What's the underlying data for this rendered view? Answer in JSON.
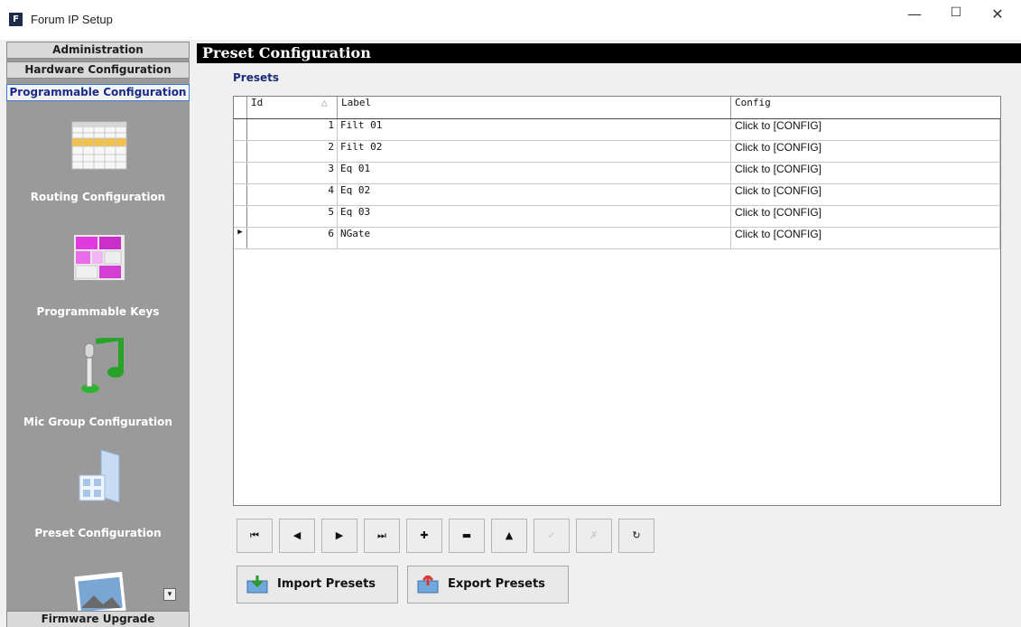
{
  "window": {
    "title": "Forum IP Setup",
    "app_icon_letter": "F",
    "minimize_glyph": "—",
    "maximize_glyph": "☐",
    "close_glyph": "✕"
  },
  "sidebar": {
    "tabs": [
      {
        "label": "Administration"
      },
      {
        "label": "Hardware Configuration"
      },
      {
        "label": "Programmable Configuration",
        "active": true
      }
    ],
    "items": [
      {
        "label": "Routing Configuration",
        "icon": "routing-grid-icon"
      },
      {
        "label": "Programmable Keys",
        "icon": "programmable-keys-icon"
      },
      {
        "label": "Mic Group Configuration",
        "icon": "microphone-music-icon"
      },
      {
        "label": "Preset Configuration",
        "icon": "preset-folder-icon"
      },
      {
        "label": "",
        "icon": "landscape-photo-icon"
      }
    ],
    "scroll_glyph": "▾",
    "bottom_tab": "Firmware Upgrade"
  },
  "main": {
    "header": "Preset Configuration",
    "section_label": "Presets",
    "grid": {
      "columns": [
        "Id",
        "Label",
        "Config"
      ],
      "sort_glyph": "△",
      "rows": [
        {
          "id": "1",
          "label": "Filt 01",
          "config": "Click to [CONFIG]"
        },
        {
          "id": "2",
          "label": "Filt 02",
          "config": "Click to [CONFIG]"
        },
        {
          "id": "3",
          "label": "Eq 01",
          "config": "Click to [CONFIG]"
        },
        {
          "id": "4",
          "label": "Eq 02",
          "config": "Click to [CONFIG]"
        },
        {
          "id": "5",
          "label": "Eq 03",
          "config": "Click to [CONFIG]"
        },
        {
          "id": "6",
          "label": "NGate",
          "config": "Click to [CONFIG]",
          "current": true
        }
      ],
      "current_row_marker": "▶"
    },
    "navigator": [
      {
        "name": "first-record-button",
        "glyph": "⏮"
      },
      {
        "name": "prior-record-button",
        "glyph": "◀"
      },
      {
        "name": "next-record-button",
        "glyph": "▶"
      },
      {
        "name": "last-record-button",
        "glyph": "⏭"
      },
      {
        "name": "insert-record-button",
        "glyph": "✚"
      },
      {
        "name": "delete-record-button",
        "glyph": "▬"
      },
      {
        "name": "edit-record-button",
        "glyph": "▲"
      },
      {
        "name": "post-record-button",
        "glyph": "✓",
        "disabled": true
      },
      {
        "name": "cancel-edit-button",
        "glyph": "✗",
        "disabled": true
      },
      {
        "name": "refresh-button",
        "glyph": "↻"
      }
    ],
    "import_button": "Import Presets",
    "export_button": "Export Presets"
  }
}
